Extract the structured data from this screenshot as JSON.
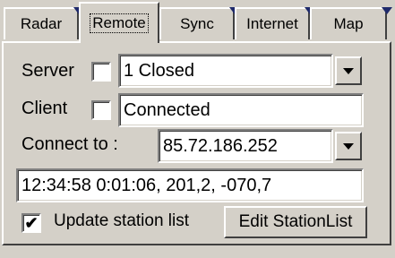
{
  "tabs": [
    {
      "label": "Radar"
    },
    {
      "label": "Remote",
      "active": true
    },
    {
      "label": "Sync"
    },
    {
      "label": "Internet"
    },
    {
      "label": "Map"
    }
  ],
  "server": {
    "label": "Server",
    "checked": false,
    "value": "1 Closed"
  },
  "client": {
    "label": "Client",
    "checked": false,
    "value": "Connected"
  },
  "connect_to": {
    "label": "Connect to :",
    "value": "85.72.186.252"
  },
  "status_line": "12:34:58 0:01:06, 201,2, -070,7",
  "update_station_list": {
    "label": "Update station list",
    "checked": true,
    "mark": "✔"
  },
  "edit_button": "Edit StationList",
  "colors": {
    "face": "#d4d0c8",
    "notch": "#1f2a6b"
  }
}
